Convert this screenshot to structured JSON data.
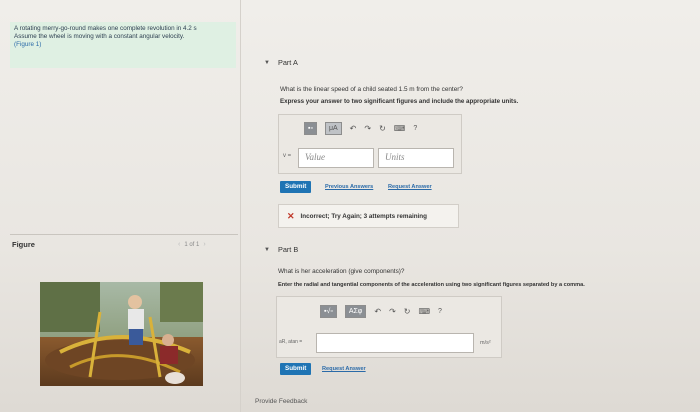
{
  "problem": {
    "line1": "A rotating merry-go-round makes one complete revolution in 4.2 s",
    "line2": "Assume the wheel is moving with a constant angular velocity.",
    "figure_link": "(Figure 1)"
  },
  "figure": {
    "label": "Figure",
    "nav_text": "1 of 1",
    "prev_arrow": "‹",
    "next_arrow": "›"
  },
  "partA": {
    "title": "Part A",
    "question": "What is the linear speed of a child seated 1.5 m from the center?",
    "instruction": "Express your answer to two significant figures and include the appropriate units.",
    "toolbar": {
      "template_label": "▪▫",
      "units_label": "μA",
      "help_label": "?"
    },
    "prefix": "v =",
    "value_placeholder": "Value",
    "units_placeholder": "Units",
    "submit_label": "Submit",
    "previous_answers": "Previous Answers",
    "request_answer": "Request Answer",
    "feedback": "Incorrect; Try Again; 3 attempts remaining",
    "feedback_icon": "✕"
  },
  "partB": {
    "title": "Part B",
    "question": "What is her acceleration (give components)?",
    "instruction": "Enter the radial and tangential components of the acceleration using two significant figures separated by a comma.",
    "toolbar": {
      "template_label": "▪√▫",
      "greek_label": "AΣφ",
      "help_label": "?"
    },
    "prefix": "aR, atan =",
    "units_suffix": "m/s²",
    "submit_label": "Submit",
    "request_answer": "Request Answer"
  },
  "footer": {
    "provide_feedback": "Provide Feedback"
  },
  "colors": {
    "accent": "#1f74b4",
    "problem_bg": "#dff0e3",
    "error": "#c0392b"
  }
}
